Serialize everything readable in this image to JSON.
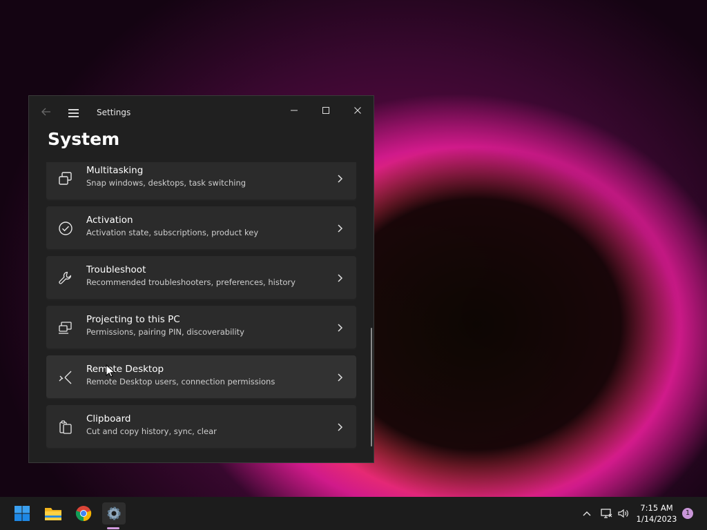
{
  "window": {
    "app_title": "Settings",
    "page_title": "System"
  },
  "settings_items": [
    {
      "icon": "multitasking-icon",
      "title": "Multitasking",
      "subtitle": "Snap windows, desktops, task switching"
    },
    {
      "icon": "activation-icon",
      "title": "Activation",
      "subtitle": "Activation state, subscriptions, product key"
    },
    {
      "icon": "troubleshoot-icon",
      "title": "Troubleshoot",
      "subtitle": "Recommended troubleshooters, preferences, history"
    },
    {
      "icon": "projecting-icon",
      "title": "Projecting to this PC",
      "subtitle": "Permissions, pairing PIN, discoverability"
    },
    {
      "icon": "remote-desktop-icon",
      "title": "Remote Desktop",
      "subtitle": "Remote Desktop users, connection permissions"
    },
    {
      "icon": "clipboard-icon",
      "title": "Clipboard",
      "subtitle": "Cut and copy history, sync, clear"
    }
  ],
  "taskbar": {
    "apps": [
      "windows-start-icon",
      "file-explorer-icon",
      "chrome-icon",
      "settings-icon"
    ],
    "clock_time": "7:15 AM",
    "clock_date": "1/14/2023",
    "notification_count": "1"
  },
  "colors": {
    "window_bg": "#202020",
    "card_bg": "#2b2b2b",
    "taskbar_bg": "#1c1c1c",
    "accent": "#c996d8"
  }
}
